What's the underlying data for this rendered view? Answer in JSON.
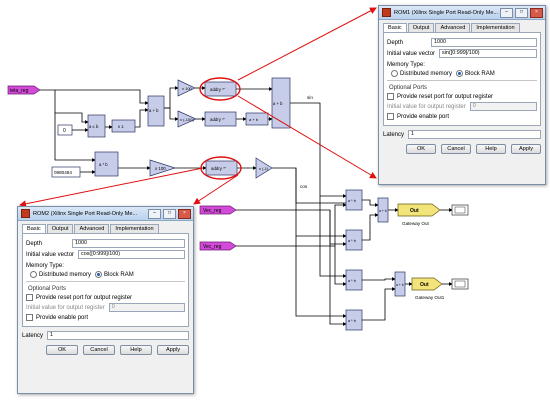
{
  "diagram": {
    "inputs": [
      {
        "label": "teta_reg"
      },
      {
        "label": "Vec_reg"
      },
      {
        "label": "Vec_reg"
      }
    ],
    "constants": [
      {
        "label": "0"
      },
      {
        "label": "0980484"
      }
    ],
    "gains": [
      {
        "label": "x 100"
      },
      {
        "label": "x (-100)"
      },
      {
        "label": "x 100"
      },
      {
        "label": "x (-1)"
      }
    ],
    "roms": [
      {
        "label": "addry *'"
      },
      {
        "label": "addry *'"
      },
      {
        "label": "addry *'"
      }
    ],
    "ops": [
      {
        "label": "a + b"
      },
      {
        "label": "a + b"
      },
      {
        "label": "a + b"
      },
      {
        "label": "a * b"
      },
      {
        "label": "a + b"
      },
      {
        "label": "x 1"
      },
      {
        "label": "a ≤ b"
      }
    ],
    "signals": {
      "sin": "sin",
      "cos": "cos"
    },
    "gateways": [
      {
        "label": "Out",
        "caption": "Gateway Out"
      },
      {
        "label": "Out",
        "caption": "Gateway Out1"
      }
    ]
  },
  "rom1": {
    "title": "ROM1 (Xilinx Single Port Read-Only Me...",
    "tabs": [
      "Basic",
      "Output",
      "Advanced",
      "Implementation"
    ],
    "depth_label": "Depth",
    "depth_value": "1000",
    "init_label": "Initial value vector",
    "init_value": "sin([0:999]/100)",
    "memtype_label": "Memory Type:",
    "mem_options": [
      "Distributed memory",
      "Block RAM"
    ],
    "optional_label": "Optional Ports",
    "reset_label": "Provide reset port for output register",
    "initout_label": "Initial value for output register",
    "initout_value": "0",
    "enable_label": "Provide enable port",
    "latency_label": "Latency",
    "latency_value": "1",
    "buttons": [
      "OK",
      "Cancel",
      "Help",
      "Apply"
    ]
  },
  "rom2": {
    "title": "ROM2 (Xilinx Single Port Read-Only Me...",
    "tabs": [
      "Basic",
      "Output",
      "Advanced",
      "Implementation"
    ],
    "depth_label": "Depth",
    "depth_value": "1000",
    "init_label": "Initial value vector",
    "init_value": "cos([0:999]/100)",
    "memtype_label": "Memory Type:",
    "mem_options": [
      "Distributed memory",
      "Block RAM"
    ],
    "optional_label": "Optional Ports",
    "reset_label": "Provide reset port for output register",
    "initout_label": "Initial value for output register",
    "initout_value": "0",
    "enable_label": "Provide enable port",
    "latency_label": "Latency",
    "latency_value": "1",
    "buttons": [
      "OK",
      "Cancel",
      "Help",
      "Apply"
    ]
  },
  "colors": {
    "block_fill": "#c7cde8",
    "block_stroke": "#2b3466",
    "input_fill": "#d24ad8",
    "gateway_fill": "#f2e47a",
    "highlight": "#e01010",
    "wire": "#000000"
  }
}
